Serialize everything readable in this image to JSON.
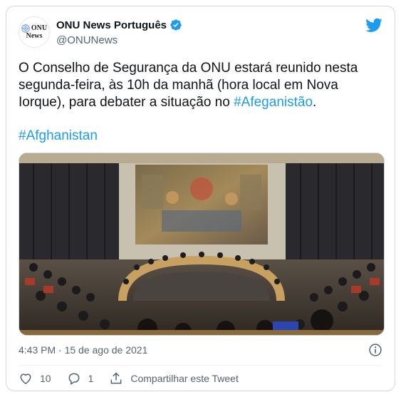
{
  "account": {
    "display_name": "ONU News Português",
    "handle": "@ONUNews",
    "avatar_logo_text": "ONU",
    "avatar_logo_subtext": "News",
    "verified": true
  },
  "tweet": {
    "text": "O Conselho de Segurança da ONU estará reunido nesta segunda-feira, às 10h da manhã (hora local em Nova Iorque), para debater a situação no ",
    "hashtag_inline": "#Afeganistão",
    "text_end": ".",
    "hashtag_line": "#Afghanistan",
    "timestamp": "4:43 PM · 15 de ago de 2021"
  },
  "actions": {
    "like_count": "10",
    "reply_count": "1",
    "share_label": "Compartilhar este Tweet"
  },
  "colors": {
    "accent": "#1d9bf0",
    "text": "#0f1419",
    "muted": "#536471",
    "border": "#cfd9de"
  },
  "icons": [
    "un-emblem-icon",
    "verified-badge-icon",
    "twitter-bird-icon",
    "info-icon",
    "heart-icon",
    "reply-icon",
    "share-icon"
  ]
}
